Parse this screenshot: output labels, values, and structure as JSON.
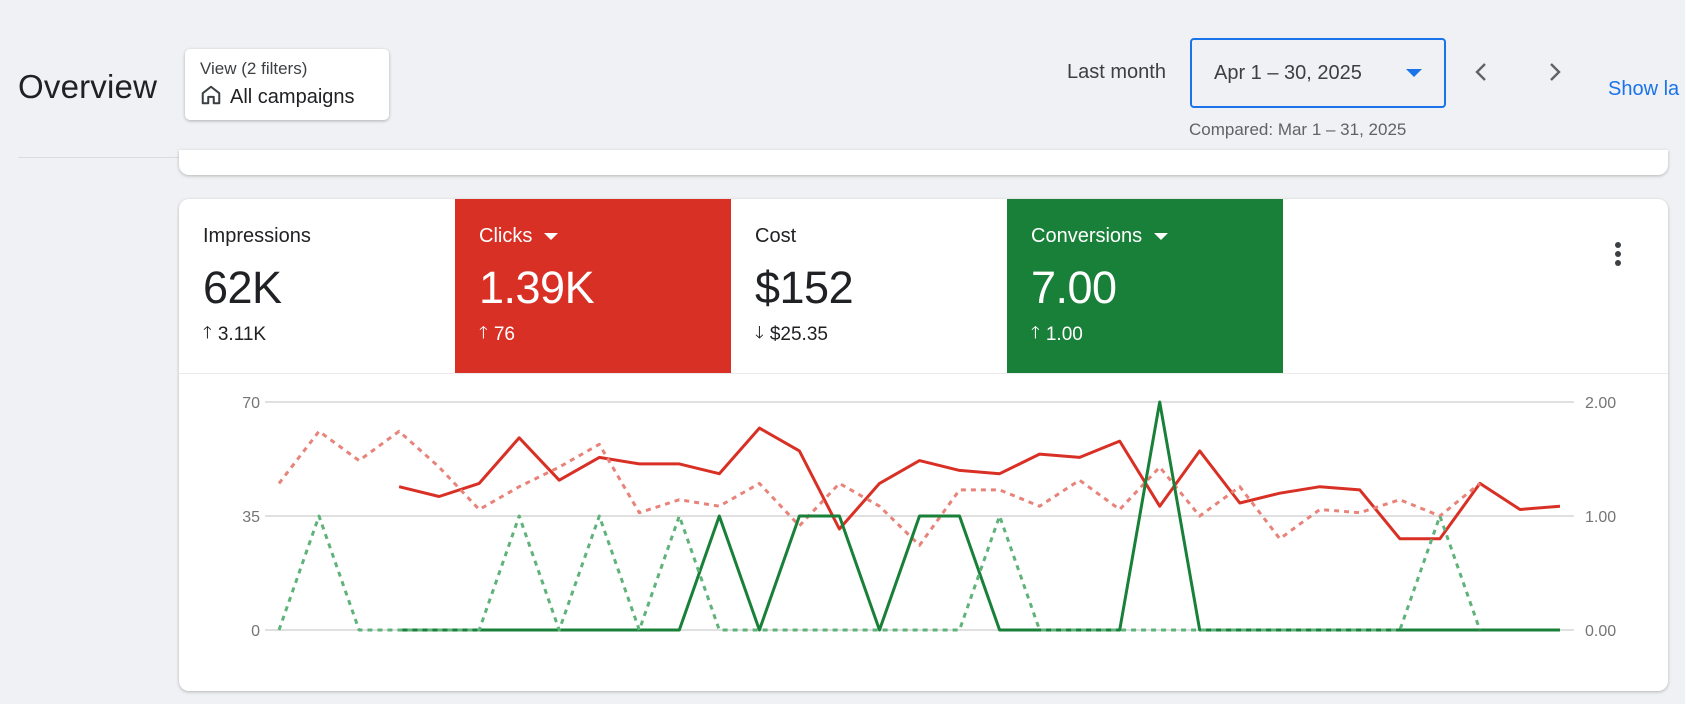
{
  "header": {
    "title": "Overview",
    "view_filter": {
      "label": "View (2 filters)",
      "value": "All campaigns",
      "icon": "store-icon"
    },
    "date_range": {
      "label": "Last month",
      "value": "Apr 1 – 30, 2025",
      "compared": "Compared: Mar 1 – 31, 2025",
      "accent": "#1a73e8"
    },
    "nav": {
      "prev_icon": "chevron-left-icon",
      "next_icon": "chevron-right-icon"
    },
    "show_link": "Show la"
  },
  "metrics": [
    {
      "label": "Impressions",
      "value": "62K",
      "delta": "3.11K",
      "direction": "up",
      "selected": false
    },
    {
      "label": "Clicks",
      "value": "1.39K",
      "delta": "76",
      "direction": "up",
      "selected": true,
      "color": "#d93025"
    },
    {
      "label": "Cost",
      "value": "$152",
      "delta": "$25.35",
      "direction": "down",
      "selected": false
    },
    {
      "label": "Conversions",
      "value": "7.00",
      "delta": "1.00",
      "direction": "up",
      "selected": true,
      "color": "#188038"
    }
  ],
  "chart_data": {
    "type": "line",
    "x": [
      1,
      2,
      3,
      4,
      5,
      6,
      7,
      8,
      9,
      10,
      11,
      12,
      13,
      14,
      15,
      16,
      17,
      18,
      19,
      20,
      21,
      22,
      23,
      24,
      25,
      26,
      27,
      28,
      29,
      30,
      31,
      32,
      33
    ],
    "y_left": {
      "ticks": [
        "70",
        "35",
        "0"
      ],
      "range": [
        0,
        70
      ]
    },
    "y_right": {
      "ticks": [
        "2.00",
        "1.00",
        "0.00"
      ],
      "range": [
        0,
        2
      ]
    },
    "grid": true,
    "series": [
      {
        "axis": "left",
        "color": "#d93025",
        "dashed": false,
        "values": [
          null,
          null,
          null,
          44,
          41,
          45,
          59,
          46,
          53,
          51,
          51,
          48,
          62,
          55,
          31,
          45,
          52,
          49,
          48,
          54,
          53,
          58,
          38,
          55,
          39,
          42,
          44,
          43,
          28,
          28,
          45,
          37,
          38
        ]
      },
      {
        "axis": "left",
        "color": "#e8837a",
        "dashed": true,
        "values": [
          45,
          61,
          52,
          61,
          50,
          37,
          44,
          50,
          57,
          36,
          40,
          38,
          45,
          32,
          45,
          38,
          26,
          43,
          43,
          38,
          46,
          37,
          50,
          35,
          44,
          28,
          37,
          36,
          40,
          35,
          45,
          null,
          null
        ]
      },
      {
        "axis": "right",
        "color": "#188038",
        "dashed": false,
        "values": [
          null,
          null,
          null,
          0,
          0,
          0,
          0,
          0,
          0,
          0,
          0,
          1,
          0,
          1,
          1,
          0,
          1,
          1,
          0,
          0,
          0,
          0,
          2,
          0,
          0,
          0,
          0,
          0,
          0,
          0,
          0,
          0,
          0
        ]
      },
      {
        "axis": "right",
        "color": "#5fb37a",
        "dashed": true,
        "values": [
          0,
          1,
          0,
          0,
          0,
          0,
          1,
          0,
          1,
          0,
          1,
          0,
          0,
          0,
          0,
          0,
          0,
          0,
          1,
          0,
          0,
          0,
          0,
          0,
          0,
          0,
          0,
          0,
          0,
          1,
          0,
          null,
          null
        ]
      }
    ]
  }
}
